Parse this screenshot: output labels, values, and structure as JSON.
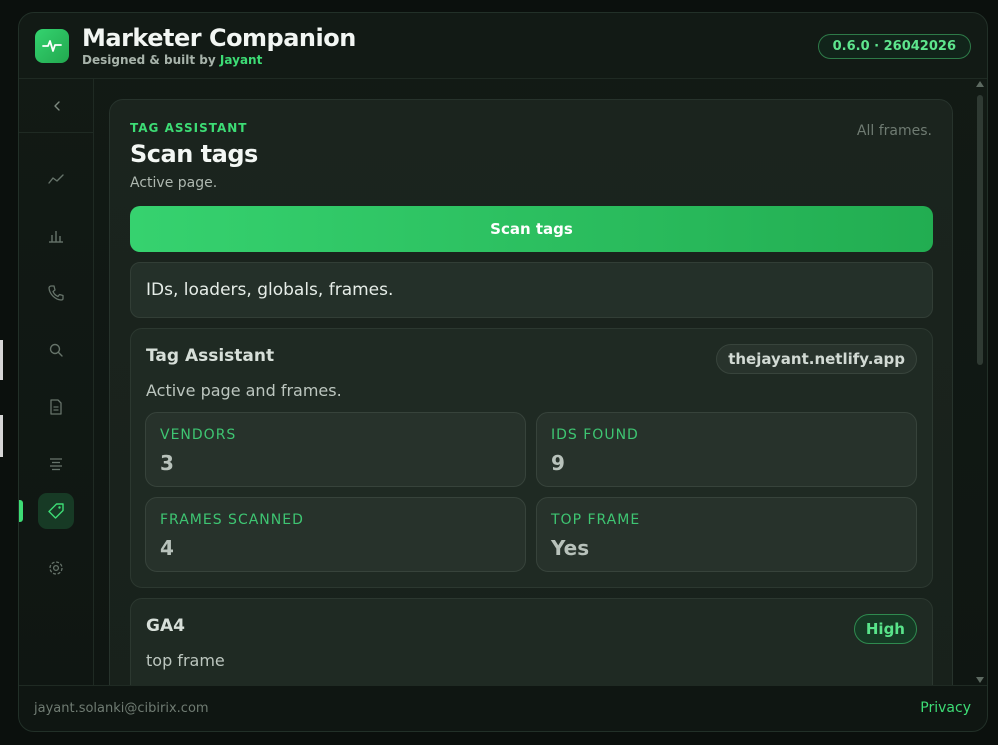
{
  "header": {
    "title": "Marketer Companion",
    "subtitle_prefix": "Designed & built by",
    "author": "Jayant",
    "version": "0.6.0 · 26042026"
  },
  "sidebar": {
    "items": [
      {
        "icon": "trend-line-icon",
        "active": false
      },
      {
        "icon": "bar-chart-icon",
        "active": false
      },
      {
        "icon": "phone-icon",
        "active": false
      },
      {
        "icon": "search-icon",
        "active": false
      },
      {
        "icon": "document-icon",
        "active": false
      },
      {
        "icon": "list-icon",
        "active": false
      },
      {
        "icon": "tag-icon",
        "active": true
      },
      {
        "icon": "gear-icon",
        "active": false
      }
    ]
  },
  "panel": {
    "eyebrow": "TAG ASSISTANT",
    "title": "Scan tags",
    "subtitle": "Active page.",
    "scope": "All frames.",
    "scan_button": "Scan tags",
    "hint": "IDs, loaders, globals, frames."
  },
  "summary_card": {
    "title": "Tag Assistant",
    "domain": "thejayant.netlify.app",
    "subtitle": "Active page and frames.",
    "stats": [
      {
        "label": "VENDORS",
        "value": "3"
      },
      {
        "label": "IDS FOUND",
        "value": "9"
      },
      {
        "label": "FRAMES SCANNED",
        "value": "4"
      },
      {
        "label": "TOP FRAME",
        "value": "Yes"
      }
    ]
  },
  "vendor_card": {
    "title": "GA4",
    "badge": "High",
    "subtitle": "top frame"
  },
  "footer": {
    "email": "jayant.solanki@cibirix.com",
    "privacy": "Privacy"
  },
  "colors": {
    "accent": "#3ddc75",
    "background": "#0b100d",
    "panel": "#1b241e"
  }
}
